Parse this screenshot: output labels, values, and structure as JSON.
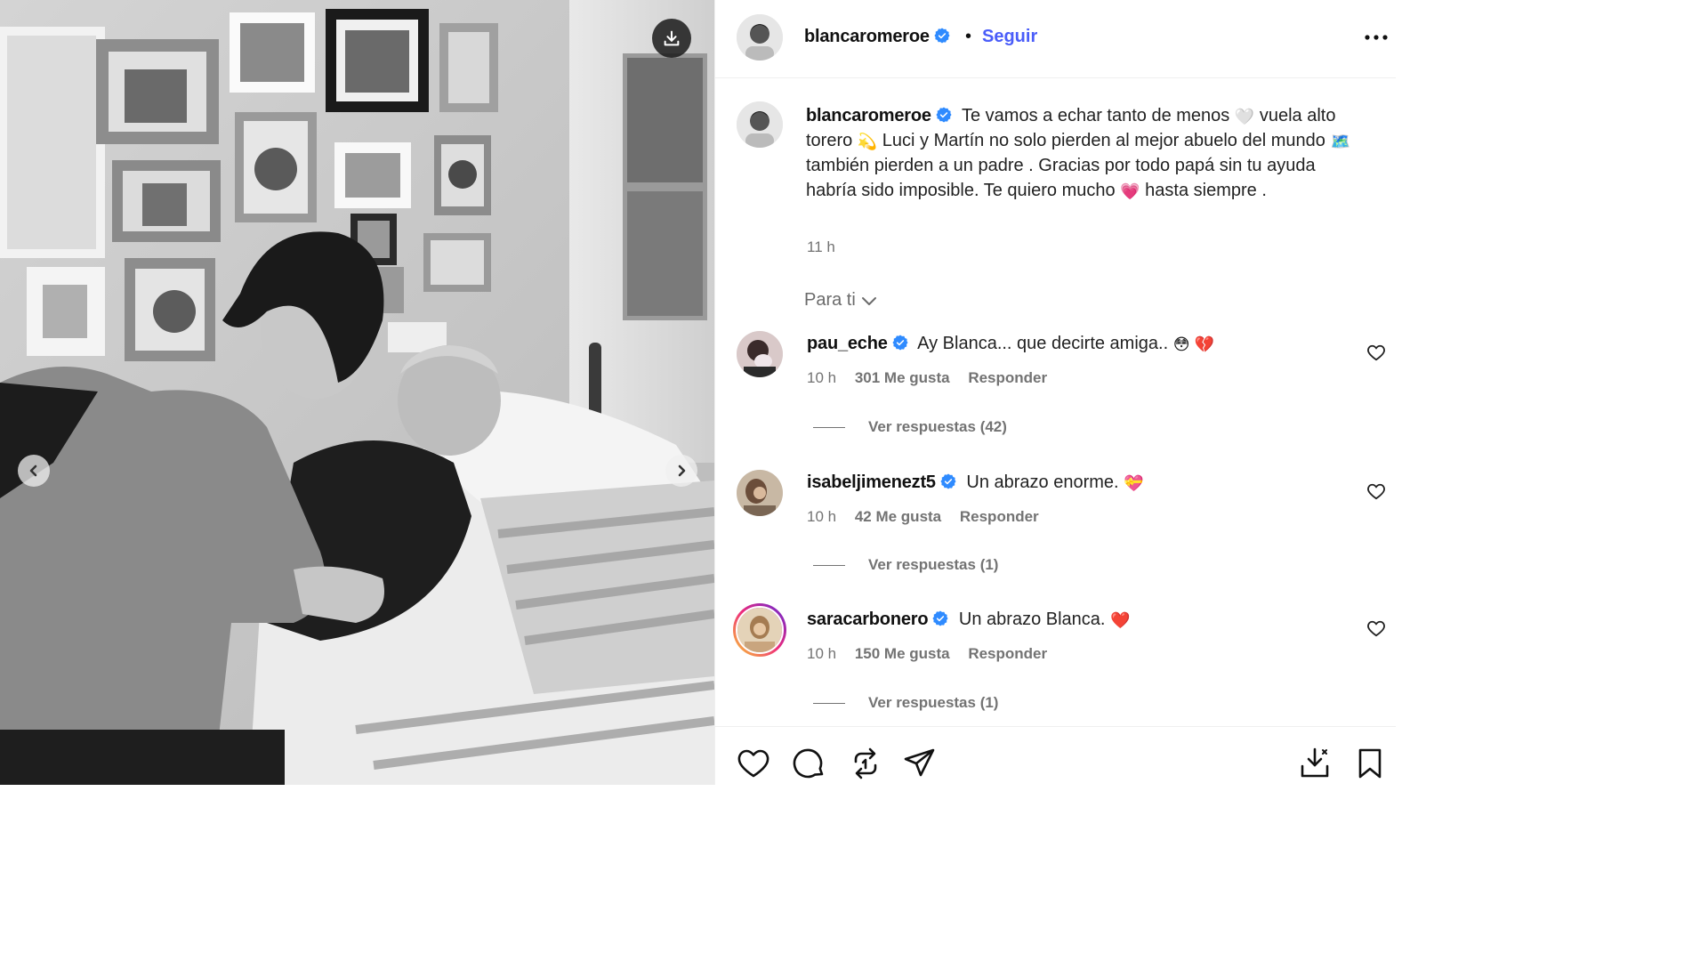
{
  "post": {
    "author": "blancaromeroe",
    "follow_label": "Seguir",
    "separator": "•"
  },
  "caption": {
    "author": "blancaromeroe",
    "text_1": "Te vamos a echar tanto de menos",
    "emoji_1": "🤍",
    "text_2": "vuela alto torero",
    "emoji_2": "💫",
    "text_3": "Luci y Martín no solo pierden al mejor abuelo del mundo",
    "emoji_3": "🗺️",
    "text_4": "también pierden a un padre . Gracias por todo papá sin tu ayuda habría sido imposible. Te quiero mucho",
    "emoji_4": "💗",
    "text_5": "hasta siempre .",
    "time": "11 h"
  },
  "comments_filter": "Para ti",
  "comments": [
    {
      "user": "pau_eche",
      "text": "Ay Blanca... que decirte amiga..",
      "emoji": "😳 💔",
      "time": "10 h",
      "likes": "301 Me gusta",
      "reply": "Responder",
      "view_replies": "Ver respuestas (42)"
    },
    {
      "user": "isabeljimenezt5",
      "text": "Un abrazo enorme.",
      "emoji": "💝",
      "time": "10 h",
      "likes": "42 Me gusta",
      "reply": "Responder",
      "view_replies": "Ver respuestas (1)"
    },
    {
      "user": "saracarbonero",
      "text": "Un abrazo Blanca.",
      "emoji": "❤️",
      "time": "10 h",
      "likes": "150 Me gusta",
      "reply": "Responder",
      "view_replies": "Ver respuestas (1)"
    }
  ],
  "icons": {
    "download": "download-icon",
    "prev": "chevron-left-icon",
    "next": "chevron-right-icon",
    "more": "more-options-icon",
    "like": "heart-icon",
    "comment": "comment-icon",
    "repost": "repost-icon",
    "share": "share-icon",
    "save_download": "save-download-icon",
    "bookmark": "bookmark-icon"
  },
  "colors": {
    "follow": "#4a5df9",
    "verified": "#2f8bff",
    "muted": "#737373"
  }
}
